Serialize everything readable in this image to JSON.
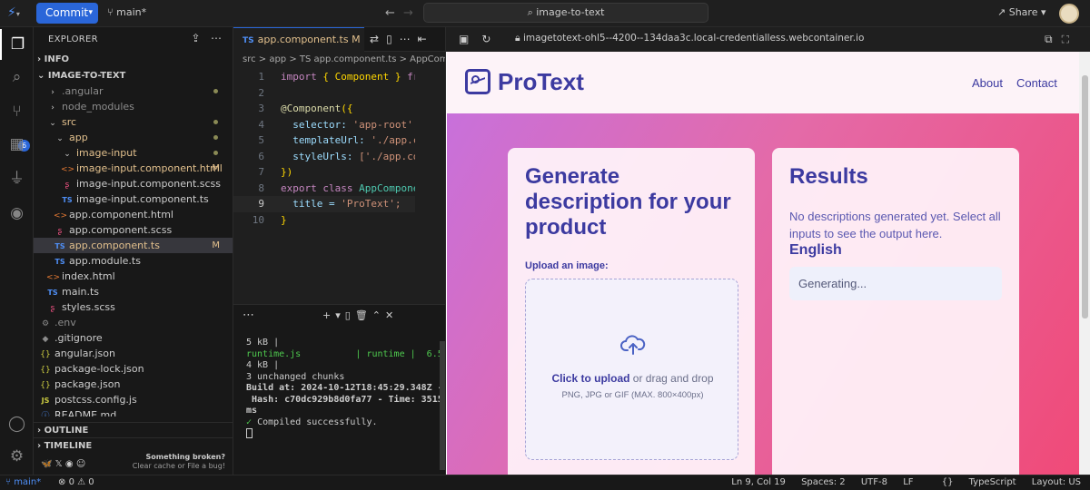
{
  "titlebar": {
    "commit_label": "Commit",
    "branch": "main*",
    "search": "image-to-text",
    "share_label": "Share"
  },
  "explorer": {
    "title": "EXPLORER",
    "info_section": "INFO",
    "project_section": "IMAGE-TO-TEXT",
    "outline_section": "OUTLINE",
    "timeline_section": "TIMELINE",
    "tree": [
      {
        "label": ".angular",
        "icon": "chevron-right-icon",
        "status": "dot"
      },
      {
        "label": "node_modules",
        "icon": "chevron-right-icon",
        "status": ""
      },
      {
        "label": "src",
        "icon": "chevron-down-icon",
        "status": "dot"
      },
      {
        "label": "app",
        "icon": "chevron-down-icon",
        "status": "dot"
      },
      {
        "label": "image-input",
        "icon": "chevron-down-icon",
        "status": "dot"
      },
      {
        "label": "image-input.component.html",
        "icon": "html-file-icon",
        "status": "M"
      },
      {
        "label": "image-input.component.scss",
        "icon": "scss-file-icon",
        "status": ""
      },
      {
        "label": "image-input.component.ts",
        "icon": "ts-file-icon",
        "status": ""
      },
      {
        "label": "app.component.html",
        "icon": "html-file-icon",
        "status": ""
      },
      {
        "label": "app.component.scss",
        "icon": "scss-file-icon",
        "status": ""
      },
      {
        "label": "app.component.ts",
        "icon": "ts-file-icon",
        "status": "M"
      },
      {
        "label": "app.module.ts",
        "icon": "ts-file-icon",
        "status": ""
      },
      {
        "label": "index.html",
        "icon": "html-file-icon",
        "status": ""
      },
      {
        "label": "main.ts",
        "icon": "ts-file-icon",
        "status": ""
      },
      {
        "label": "styles.scss",
        "icon": "scss-file-icon",
        "status": ""
      },
      {
        "label": ".env",
        "icon": "gear-file-icon",
        "status": ""
      },
      {
        "label": ".gitignore",
        "icon": "gear-file-icon",
        "status": ""
      },
      {
        "label": "angular.json",
        "icon": "json-file-icon",
        "status": ""
      },
      {
        "label": "package-lock.json",
        "icon": "json-file-icon",
        "status": ""
      },
      {
        "label": "package.json",
        "icon": "json-file-icon",
        "status": ""
      },
      {
        "label": "postcss.config.js",
        "icon": "js-file-icon",
        "status": ""
      },
      {
        "label": "README.md",
        "icon": "info-file-icon",
        "status": ""
      }
    ],
    "broken_title": "Something broken?",
    "broken_sub": "Clear cache or File a bug!"
  },
  "editor": {
    "tab_label": "app.component.ts",
    "tab_status": "M",
    "breadcrumb": "src > app > TS app.component.ts > AppComp",
    "lines": [
      {
        "n": "1"
      },
      {
        "n": "2"
      },
      {
        "n": "3"
      },
      {
        "n": "4"
      },
      {
        "n": "5"
      },
      {
        "n": "6"
      },
      {
        "n": "7"
      },
      {
        "n": "8"
      },
      {
        "n": "9"
      },
      {
        "n": "10"
      }
    ],
    "code": {
      "import_kw": "import",
      "import_body": " { Component } ",
      "from_kw": "from",
      "decorator": "@Component",
      "selector_key": "  selector: ",
      "selector_val": "'app-root',",
      "template_key": "  templateUrl: ",
      "template_val": "'./app.com",
      "style_key": "  styleUrls: ",
      "style_val": "['./app.comp",
      "close": "})",
      "export_kw": "export class ",
      "class_name": "AppComponent",
      "title_key": "  title = ",
      "title_val": "'ProText';",
      "brace": "}"
    }
  },
  "terminal": {
    "lines": [
      "5 kB |",
      "runtime.js          | runtime |  6.5",
      "4 kB |",
      "",
      "3 unchanged chunks",
      "",
      "Build at: 2024-10-12T18:45:29.348Z -",
      " Hash: c70dc929b8d0fa77 - Time: 3515",
      "ms",
      ""
    ],
    "compiled": "Compiled successfully."
  },
  "browser": {
    "url": "imagetotext-ohl5--4200--134daa3c.local-credentialless.webcontainer.io"
  },
  "site": {
    "brand": "ProText",
    "nav_about": "About",
    "nav_contact": "Contact",
    "gen_title": "Generate description for your product",
    "upload_label": "Upload an image:",
    "click_upload": "Click to upload",
    "drag_drop": " or drag and drop",
    "file_hint": "PNG, JPG or GIF (MAX. 800×400px)",
    "results_title": "Results",
    "results_empty": "No descriptions generated yet. Select all inputs to see the output here.",
    "language": "English",
    "generating": "Generating..."
  },
  "statusbar": {
    "branch": "main*",
    "errors": "0",
    "warnings": "0",
    "position": "Ln 9, Col 19",
    "spaces": "Spaces: 2",
    "encoding": "UTF-8",
    "eol": "LF",
    "language": "TypeScript",
    "layout": "Layout: US"
  },
  "colors": {
    "accent": "#2a66d9",
    "brand": "#3c3aa0",
    "modified": "#e2c08d"
  }
}
